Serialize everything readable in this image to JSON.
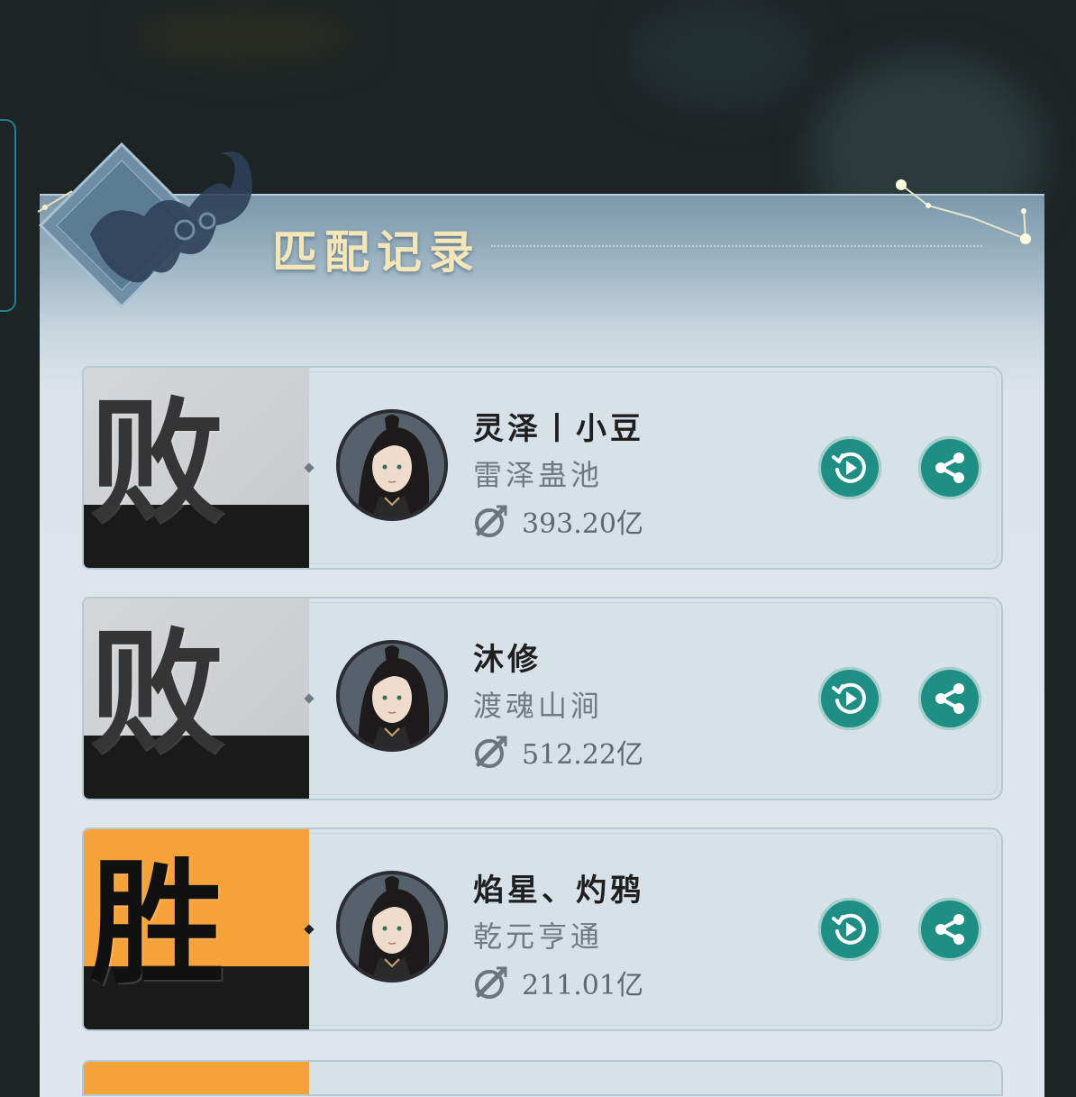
{
  "panel": {
    "title": "匹配记录"
  },
  "colors": {
    "win": "#f6a23b",
    "lose": "#d0d3d5",
    "button": "#1f8f86",
    "title": "#f4e6b8"
  },
  "records": [
    {
      "result": "败",
      "outcome": "lose",
      "player_name": "灵泽丨小豆",
      "server": "雷泽蛊池",
      "power": "393.20亿",
      "icons": [
        "avatar",
        "power-icon",
        "replay-icon",
        "share-icon"
      ]
    },
    {
      "result": "败",
      "outcome": "lose",
      "player_name": "沐修",
      "server": "渡魂山涧",
      "power": "512.22亿",
      "icons": [
        "avatar",
        "power-icon",
        "replay-icon",
        "share-icon"
      ]
    },
    {
      "result": "胜",
      "outcome": "win",
      "player_name": "焰星、灼鸦",
      "server": "乾元亨通",
      "power": "211.01亿",
      "icons": [
        "avatar",
        "power-icon",
        "replay-icon",
        "share-icon"
      ]
    }
  ]
}
